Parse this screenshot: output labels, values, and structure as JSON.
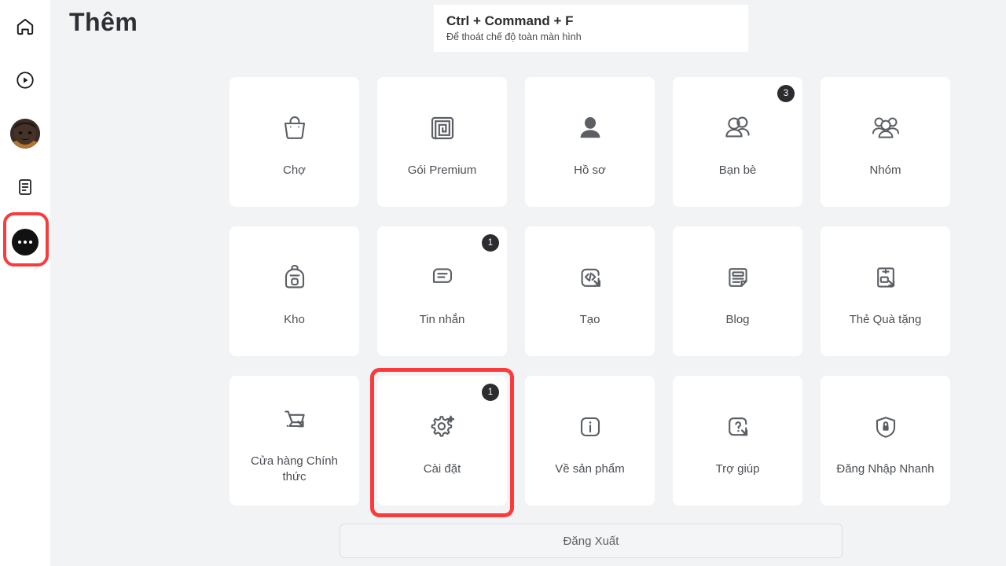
{
  "page": {
    "title": "Thêm",
    "background_color": "#f2f3f5",
    "card_color": "#ffffff",
    "highlight_color": "#fb3b3b"
  },
  "tooltip": {
    "title": "Ctrl + Command + F",
    "subtitle": "Để thoát chế độ toàn màn hình"
  },
  "sidebar": {
    "items": [
      {
        "name": "home",
        "icon": "home-icon",
        "active": false
      },
      {
        "name": "video",
        "icon": "play-circle-icon",
        "active": false
      },
      {
        "name": "profile",
        "icon": "avatar-icon",
        "active": false
      },
      {
        "name": "feed",
        "icon": "document-list-icon",
        "active": false
      },
      {
        "name": "more",
        "icon": "ellipsis-icon",
        "active": true
      }
    ]
  },
  "grid": {
    "cards": [
      {
        "label": "Chợ",
        "icon": "shopping-bag-icon",
        "badge": ""
      },
      {
        "label": "Gói Premium",
        "icon": "premium-maze-icon",
        "badge": ""
      },
      {
        "label": "Hồ sơ",
        "icon": "person-icon",
        "badge": ""
      },
      {
        "label": "Bạn bè",
        "icon": "friends-icon",
        "badge": "3"
      },
      {
        "label": "Nhóm",
        "icon": "groups-icon",
        "badge": ""
      },
      {
        "label": "Kho",
        "icon": "backpack-icon",
        "badge": ""
      },
      {
        "label": "Tin nhắn",
        "icon": "message-icon",
        "badge": "1"
      },
      {
        "label": "Tạo",
        "icon": "code-create-icon",
        "badge": ""
      },
      {
        "label": "Blog",
        "icon": "blog-note-icon",
        "badge": ""
      },
      {
        "label": "Thẻ Quà tặng",
        "icon": "gift-card-icon",
        "badge": ""
      },
      {
        "label": "Cửa hàng Chính thức",
        "icon": "shopping-cart-icon",
        "badge": ""
      },
      {
        "label": "Cài đặt",
        "icon": "settings-gear-icon",
        "badge": "1"
      },
      {
        "label": "Về sản phẩm",
        "icon": "info-icon",
        "badge": ""
      },
      {
        "label": "Trợ giúp",
        "icon": "help-question-icon",
        "badge": ""
      },
      {
        "label": "Đăng Nhập Nhanh",
        "icon": "shield-lock-icon",
        "badge": ""
      }
    ]
  },
  "logout": {
    "label": "Đăng Xuất"
  }
}
